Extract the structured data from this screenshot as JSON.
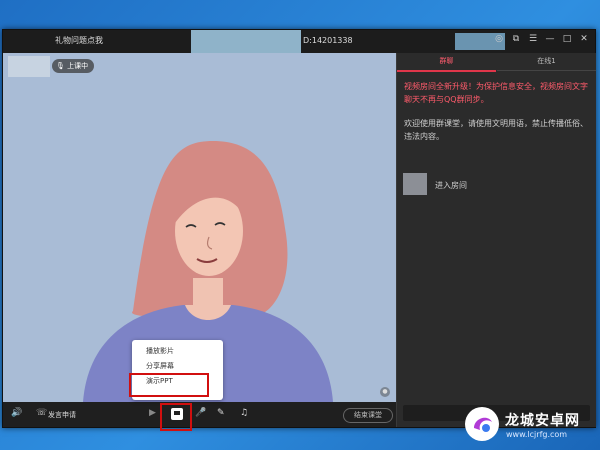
{
  "window": {
    "title": "礼物问题点我",
    "room_id": "D:14201338",
    "controls": [
      "settings-icon",
      "external-icon",
      "menu-icon",
      "minimize-icon",
      "maximize-icon",
      "close-icon"
    ]
  },
  "video": {
    "status_badge": "上课中"
  },
  "popup_menu": {
    "items": [
      "播放影片",
      "分享屏幕",
      "演示PPT"
    ]
  },
  "bottom_bar": {
    "apply_label": "发言申请",
    "end_class_label": "结束课堂"
  },
  "side_panel": {
    "tabs": [
      "群聊",
      "在线1"
    ],
    "notice": "视频房间全新升级！为保护信息安全，视频房间文字聊天不再与QQ群同步。",
    "welcome": "欢迎使用群课堂，请使用文明用语，禁止传播低俗、违法内容。",
    "enter_text": "进入房间"
  },
  "watermark": {
    "title": "龙城安卓网",
    "url": "www.lcjrfg.com"
  },
  "colors": {
    "accent": "#e0364a",
    "highlight": "#d10f0f",
    "video_bg": "#a9bcd6"
  }
}
